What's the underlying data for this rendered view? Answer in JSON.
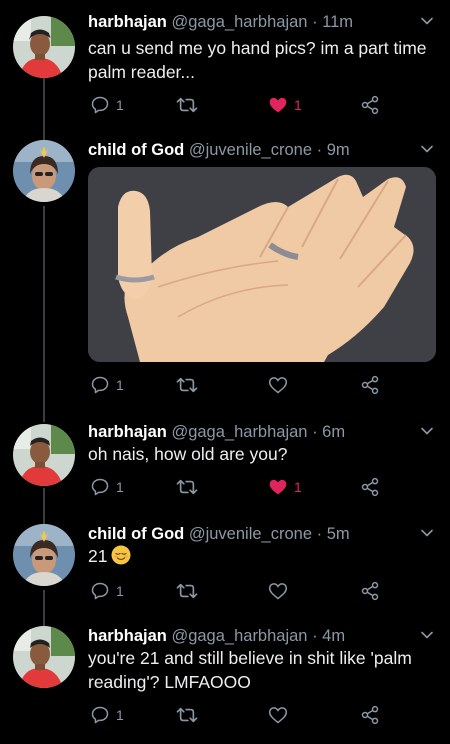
{
  "tweets": [
    {
      "name": "harbhajan",
      "handle": "@gaga_harbhajan",
      "dot": "·",
      "time": "11m",
      "text_lines": [
        "can u send me yo hand pics? im a part time",
        "palm reader..."
      ],
      "reply_count": "1",
      "like_count": "1",
      "liked": true
    },
    {
      "name": "child of God",
      "handle": "@juvenile_crone",
      "dot": "·",
      "time": "9m",
      "reply_count": "1",
      "like_count": "",
      "liked": false
    },
    {
      "name": "harbhajan",
      "handle": "@gaga_harbhajan",
      "dot": "·",
      "time": "6m",
      "text": "oh nais, how old are you?",
      "reply_count": "1",
      "like_count": "1",
      "liked": true
    },
    {
      "name": "child of God",
      "handle": "@juvenile_crone",
      "dot": "·",
      "time": "5m",
      "text": "21",
      "reply_count": "1",
      "like_count": "",
      "liked": false
    },
    {
      "name": "harbhajan",
      "handle": "@gaga_harbhajan",
      "dot": "·",
      "time": "4m",
      "text_lines": [
        "you're 21 and still believe in shit like 'palm",
        "reading'? LMFAOOO"
      ],
      "reply_count": "1",
      "like_count": "",
      "liked": false
    }
  ],
  "icons": {
    "reply": "reply-icon",
    "retweet": "retweet-icon",
    "like": "heart-icon",
    "share": "share-icon",
    "menu": "chevron-down-icon",
    "emoji": "relieved-face-emoji"
  },
  "colors": {
    "background": "#000000",
    "text": "#e9eaeb",
    "muted": "#8b98a5",
    "like": "#e0245e",
    "thread_line": "#3a3d40"
  }
}
